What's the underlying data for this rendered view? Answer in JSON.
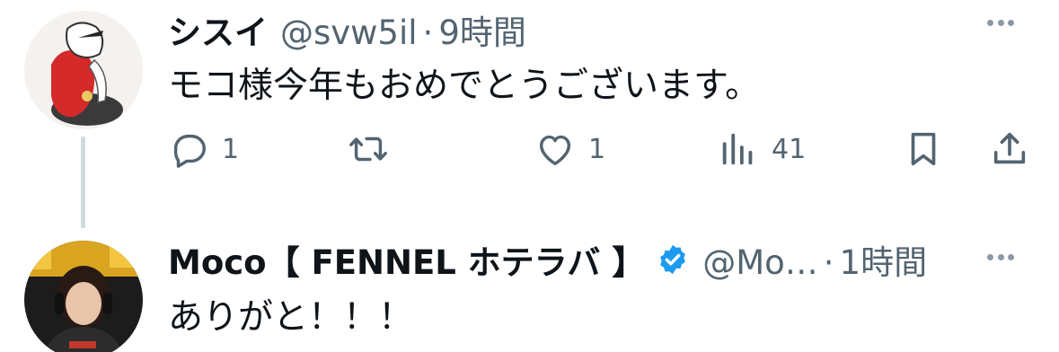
{
  "tweets": [
    {
      "author_name": "シスイ",
      "handle": "@svw5il",
      "separator": "·",
      "time": "9時間",
      "text": "モコ様今年もおめでとうございます。",
      "counts": {
        "reply": "1",
        "like": "1",
        "views": "41"
      }
    },
    {
      "author_name": "Moco【 FENNEL ホテラバ 】",
      "handle": "@Mo…",
      "separator": "·",
      "time": "1時間",
      "text": "ありがと！！！",
      "verified": true
    }
  ],
  "icons": {
    "reply": "reply-icon",
    "retweet": "retweet-icon",
    "like": "heart-icon",
    "views": "views-icon",
    "bookmark": "bookmark-icon",
    "share": "share-icon",
    "more": "more-icon",
    "verified": "verified-badge-icon"
  },
  "colors": {
    "text_primary": "#0f1419",
    "text_secondary": "#536471",
    "icon": "#536471",
    "verified_blue": "#1d9bf0",
    "thread_line": "#cfd9de"
  }
}
